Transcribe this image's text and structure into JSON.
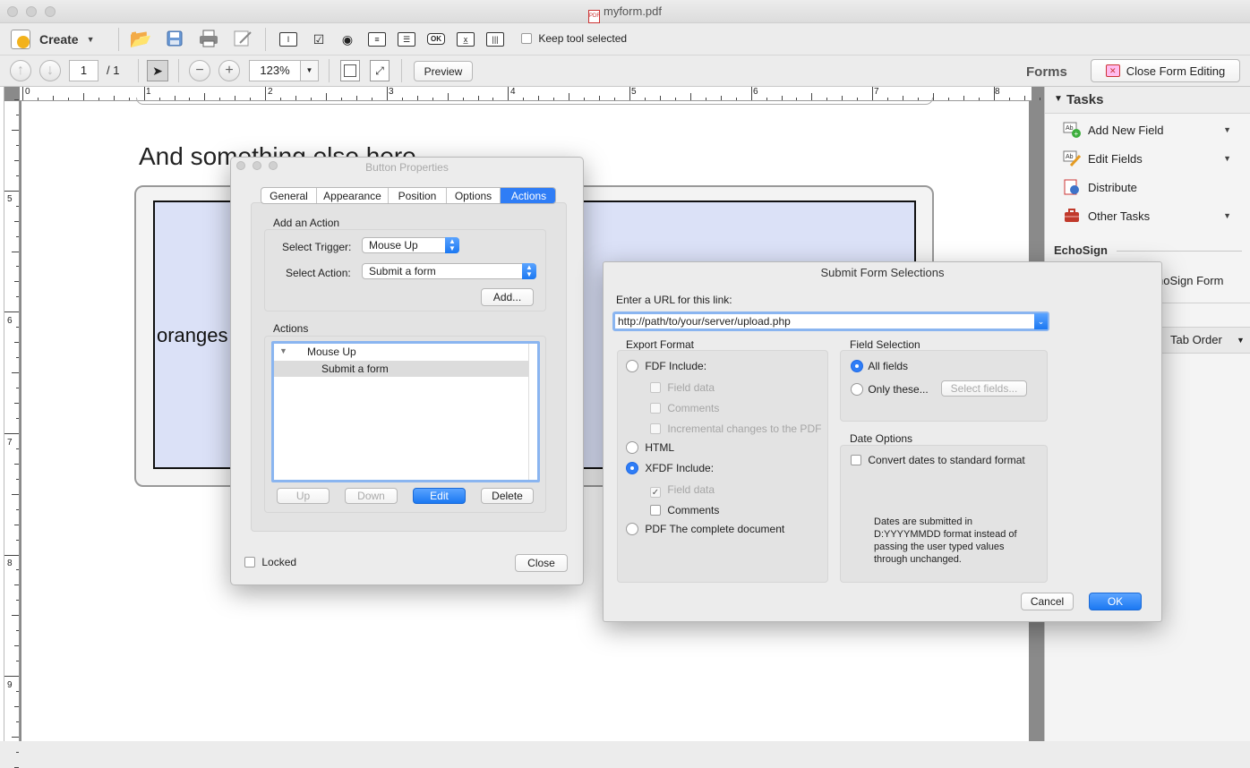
{
  "window": {
    "title": "myform.pdf"
  },
  "toolbar": {
    "create_label": "Create",
    "keep_tool_label": "Keep tool selected",
    "form_field_icons": [
      "text-field-icon",
      "checkbox-icon",
      "radio-icon",
      "list-icon",
      "dropdown-icon",
      "OK",
      "signature-icon",
      "barcode-icon"
    ]
  },
  "nav": {
    "page_current": "1",
    "page_total": "/ 1",
    "zoom": "123%",
    "preview_label": "Preview",
    "forms_label": "Forms",
    "close_form_editing": "Close Form Editing"
  },
  "ruler": {
    "top": [
      "0",
      "1",
      "2",
      "3",
      "4",
      "5",
      "6",
      "7",
      "8"
    ],
    "left": [
      "5",
      "6",
      "7",
      "8",
      "9"
    ]
  },
  "document": {
    "heading": "And something else here",
    "field_text": "oranges"
  },
  "right_panel": {
    "tasks_header": "Tasks",
    "items": [
      {
        "label": "Add New Field",
        "icon": "add-field-icon"
      },
      {
        "label": "Edit Fields",
        "icon": "edit-fields-icon"
      },
      {
        "label": "Distribute",
        "icon": "distribute-icon"
      },
      {
        "label": "Other Tasks",
        "icon": "other-tasks-icon"
      }
    ],
    "echosign_header": "EchoSign",
    "echosign_item": "hoSign Form",
    "tab_order": "Tab Order"
  },
  "button_properties": {
    "title": "Button Properties",
    "tabs": [
      "General",
      "Appearance",
      "Position",
      "Options",
      "Actions"
    ],
    "active_tab": "Actions",
    "add_action_label": "Add an Action",
    "trigger_label": "Select Trigger:",
    "trigger_value": "Mouse Up",
    "action_label": "Select Action:",
    "action_value": "Submit a form",
    "add_button": "Add...",
    "actions_label": "Actions",
    "tree_parent": "Mouse Up",
    "tree_child": "Submit a form",
    "up_button": "Up",
    "down_button": "Down",
    "edit_button": "Edit",
    "delete_button": "Delete",
    "locked_label": "Locked",
    "close_button": "Close"
  },
  "submit_form": {
    "title": "Submit Form Selections",
    "url_label": "Enter a URL for this link:",
    "url_value": "http://path/to/your/server/upload.php",
    "export_format_label": "Export Format",
    "fdf_label": "FDF  Include:",
    "fdf_field_data": "Field data",
    "fdf_comments": "Comments",
    "fdf_incremental": "Incremental changes to the PDF",
    "html_label": "HTML",
    "xfdf_label": "XFDF  Include:",
    "xfdf_field_data": "Field data",
    "xfdf_comments": "Comments",
    "pdf_label": "PDF  The complete document",
    "field_selection_label": "Field Selection",
    "all_fields": "All fields",
    "only_these": "Only these...",
    "select_fields": "Select fields...",
    "date_options_label": "Date Options",
    "convert_dates": "Convert dates to standard format",
    "date_note": "Dates are submitted in D:YYYYMMDD format instead of passing the user typed values through unchanged.",
    "cancel_button": "Cancel",
    "ok_button": "OK"
  }
}
